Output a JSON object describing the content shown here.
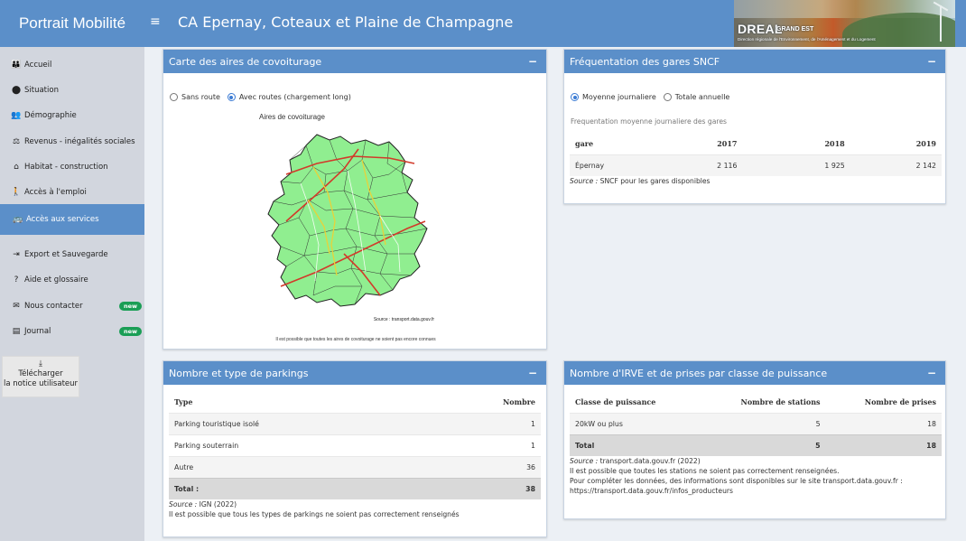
{
  "header": {
    "app_title": "Portrait Mobilité",
    "menu_icon": "hamburger-icon",
    "page_title": "CA Epernay, Coteaux et Plaine de Champagne",
    "banner_title": "DREAL",
    "banner_subtitle": "GRAND EST",
    "banner_caption": "Direction régionale de l'Environnement, de l'Aménagement et du Logement"
  },
  "sidebar": {
    "items": [
      {
        "label": "Accueil",
        "icon": "people-icon"
      },
      {
        "label": "Situation",
        "icon": "map-marker-icon"
      },
      {
        "label": "Démographie",
        "icon": "users-icon"
      },
      {
        "label": "Revenus - inégalités sociales",
        "icon": "balance-scale-icon"
      },
      {
        "label": "Habitat - construction",
        "icon": "home-icon"
      },
      {
        "label": "Accès à l'emploi",
        "icon": "walking-person-icon"
      },
      {
        "label": "Accès aux services",
        "icon": "bus-icon"
      },
      {
        "label": "Export et Sauvegarde",
        "icon": "export-icon"
      },
      {
        "label": "Aide et glossaire",
        "icon": "question-circle-icon"
      },
      {
        "label": "Nous contacter",
        "icon": "envelope-icon",
        "badge": "new"
      },
      {
        "label": "Journal",
        "icon": "newspaper-icon",
        "badge": "new"
      }
    ],
    "download": {
      "line1": "Télécharger",
      "line2": "la notice utilisateur"
    }
  },
  "covoit": {
    "title": "Carte des aires de covoiturage",
    "radio_a": "Sans route",
    "radio_b": "Avec routes (chargement long)",
    "selected": "Avec routes (chargement long)",
    "map_title": "Aires de covoiturage",
    "map_source": "Source : transport.data.gouv.fr",
    "map_note": "Il est possible que toutes les aires de covoiturage ne soient pas encore connues"
  },
  "gares": {
    "title": "Fréquentation des gares SNCF",
    "radio_a": "Moyenne journaliere",
    "radio_b": "Totale annuelle",
    "selected": "Moyenne journaliere",
    "caption": "Frequentation moyenne journaliere des gares",
    "columns": [
      "gare",
      "2017",
      "2018",
      "2019"
    ],
    "rows": [
      [
        "Épernay",
        "2 116",
        "1 925",
        "2 142"
      ]
    ],
    "source_label": "Source :",
    "source_text": " SNCF pour les gares disponibles"
  },
  "parkings": {
    "title": "Nombre et type de parkings",
    "columns": [
      "Type",
      "Nombre"
    ],
    "rows": [
      [
        "Parking touristique isolé",
        "1"
      ],
      [
        "Parking souterrain",
        "1"
      ],
      [
        "Autre",
        "36"
      ]
    ],
    "total": [
      "Total :",
      "38"
    ],
    "source_label": "Source :",
    "source_text": " IGN (2022)",
    "note": "Il est possible que tous les types de parkings ne soient pas correctement renseignés"
  },
  "irve": {
    "title": "Nombre d'IRVE et de prises par classe de puissance",
    "columns": [
      "Classe de puissance",
      "Nombre de stations",
      "Nombre de prises"
    ],
    "rows": [
      [
        "20kW ou plus",
        "5",
        "18"
      ]
    ],
    "total": [
      "Total",
      "5",
      "18"
    ],
    "source_label": "Source :",
    "source_text": " transport.data.gouv.fr (2022)",
    "note1": "Il est possible que toutes les stations ne soient pas correctement renseignées.",
    "note2": "Pour compléter les données, des informations sont disponibles sur le site transport.data.gouv.fr :",
    "note3": "https://transport.data.gouv.fr/infos_producteurs"
  },
  "colors": {
    "accent": "#5b8fc9",
    "sidebar": "#d2d6de",
    "badge": "#1a9e55",
    "map_fill": "#90ee90"
  }
}
